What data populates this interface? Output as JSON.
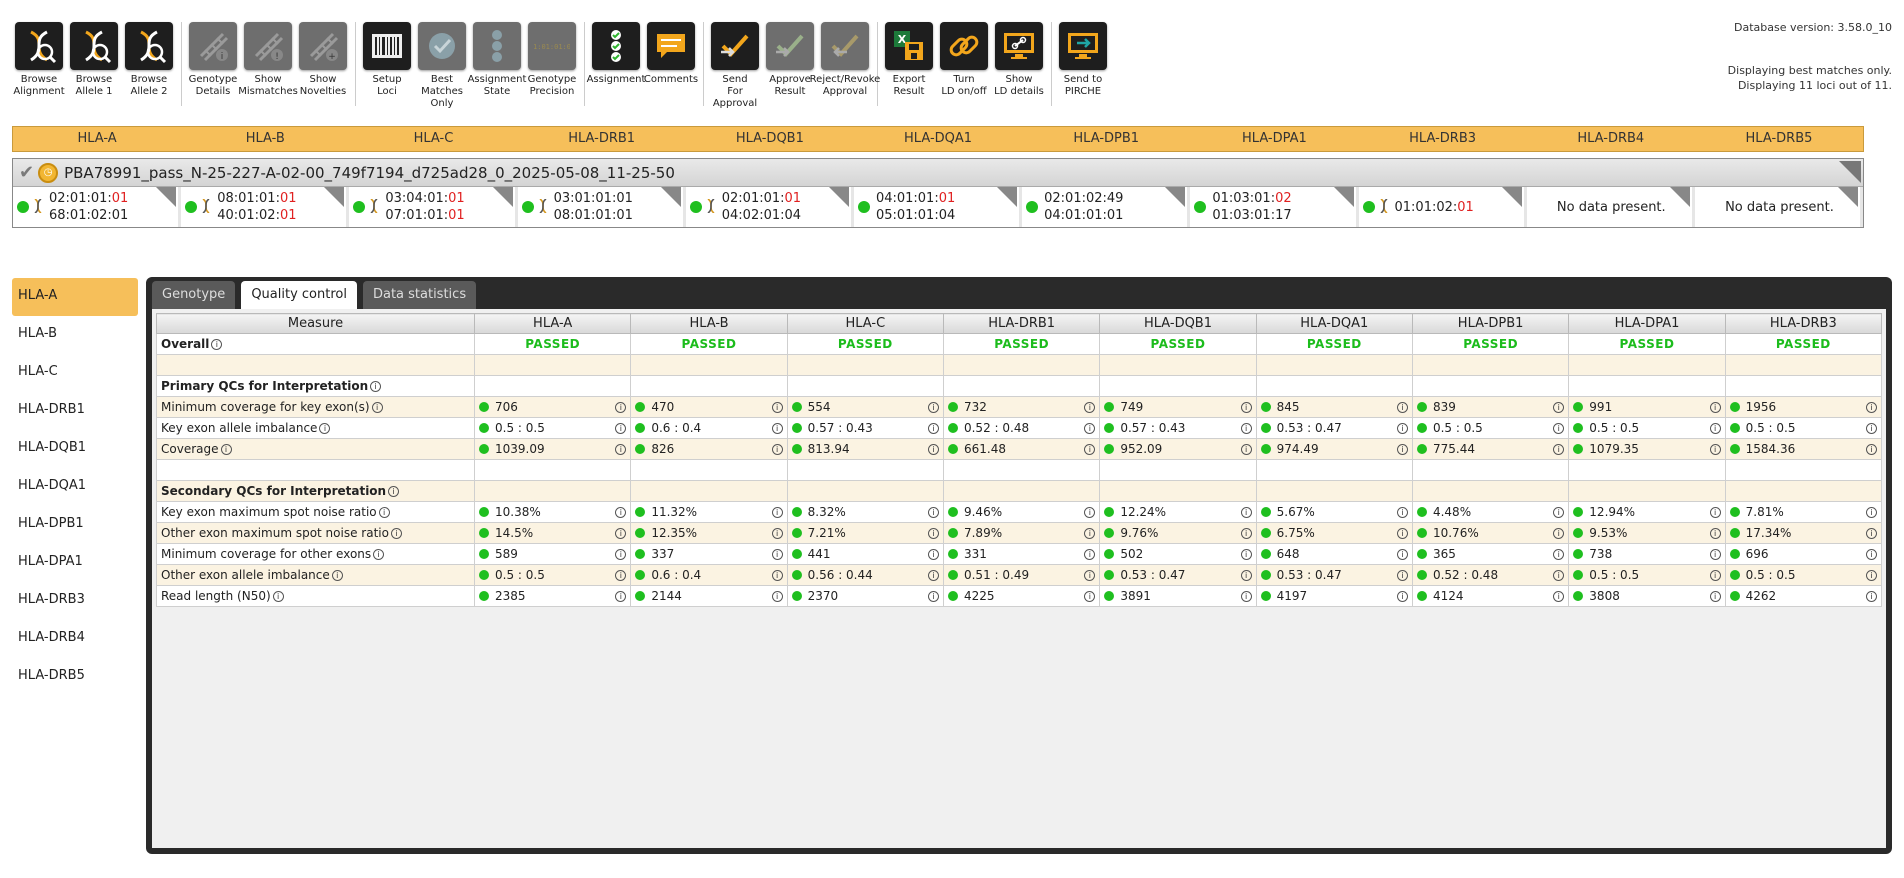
{
  "toolbar": {
    "groups": [
      [
        {
          "label": "Browse\nAlignment",
          "icon": "dna-browse-icon",
          "disabled": false
        },
        {
          "label": "Browse\nAllele 1",
          "icon": "dna-browse-icon",
          "disabled": false
        },
        {
          "label": "Browse\nAllele 2",
          "icon": "dna-browse-icon",
          "disabled": false
        }
      ],
      [
        {
          "label": "Genotype\nDetails",
          "icon": "dna-info-icon",
          "disabled": true
        },
        {
          "label": "Show\nMismatches",
          "icon": "dna-warning-icon",
          "disabled": true
        },
        {
          "label": "Show\nNovelties",
          "icon": "dna-plus-icon",
          "disabled": true
        }
      ],
      [
        {
          "label": "Setup\nLoci",
          "icon": "barcode-icon",
          "disabled": false
        },
        {
          "label": "Best Matches\nOnly",
          "icon": "check-circle-icon",
          "disabled": true
        },
        {
          "label": "Assignment\nState",
          "icon": "state-icon",
          "disabled": true
        },
        {
          "label": "Genotype\nPrecision",
          "icon": "binary-icon",
          "disabled": true
        }
      ],
      [
        {
          "label": "Assignment",
          "icon": "checklist-icon",
          "disabled": false
        },
        {
          "label": "Comments",
          "icon": "comment-icon",
          "disabled": false
        }
      ],
      [
        {
          "label": "Send\nFor Approval",
          "icon": "send-approval-icon",
          "disabled": false
        },
        {
          "label": "Approve\nResult",
          "icon": "approve-icon",
          "disabled": true
        },
        {
          "label": "Reject/Revoke\nApproval",
          "icon": "reject-icon",
          "disabled": true
        }
      ],
      [
        {
          "label": "Export\nResult",
          "icon": "export-excel-icon",
          "disabled": false
        },
        {
          "label": "Turn\nLD on/off",
          "icon": "link-icon",
          "disabled": false
        },
        {
          "label": "Show\nLD details",
          "icon": "monitor-link-icon",
          "disabled": false
        }
      ],
      [
        {
          "label": "Send to\nPIRCHE",
          "icon": "monitor-send-icon",
          "disabled": false
        }
      ]
    ]
  },
  "db_info": {
    "version": "Database version: 3.58.0_10",
    "line1": "Displaying best matches only.",
    "line2": "Displaying 11 loci out of 11."
  },
  "loci": [
    "HLA-A",
    "HLA-B",
    "HLA-C",
    "HLA-DRB1",
    "HLA-DQB1",
    "HLA-DQA1",
    "HLA-DPB1",
    "HLA-DPA1",
    "HLA-DRB3",
    "HLA-DRB4",
    "HLA-DRB5"
  ],
  "sample": {
    "name": "PBA78991_pass_N-25-227-A-02-00_749f7194_d725ad28_0_2025-05-08_11-25-50",
    "cells": [
      {
        "dna": true,
        "a1": [
          "02:01:01:",
          "01"
        ],
        "a2": [
          "68:01:02:01",
          ""
        ]
      },
      {
        "dna": true,
        "a1": [
          "08:01:01:",
          "01"
        ],
        "a2": [
          "40:01:02:",
          "01"
        ]
      },
      {
        "dna": true,
        "a1": [
          "03:04:01:",
          "01"
        ],
        "a2": [
          "07:01:01:",
          "01"
        ]
      },
      {
        "dna": true,
        "a1": [
          "03:01:01:01",
          ""
        ],
        "a2": [
          "08:01:01:01",
          ""
        ]
      },
      {
        "dna": true,
        "a1": [
          "02:01:01:",
          "01"
        ],
        "a2": [
          "04:02:01:04",
          ""
        ]
      },
      {
        "dna": false,
        "a1": [
          "04:01:01:",
          "01"
        ],
        "a2": [
          "05:01:01:04",
          ""
        ]
      },
      {
        "dna": false,
        "a1": [
          "02:01:02:49",
          ""
        ],
        "a2": [
          "04:01:01:01",
          ""
        ]
      },
      {
        "dna": false,
        "a1": [
          "01:03:01:",
          "02"
        ],
        "a2": [
          "01:03:01:17",
          ""
        ]
      },
      {
        "dna": true,
        "a1": [
          "01:01:02:",
          "01"
        ],
        "a2": null
      },
      {
        "nodata": "No data present."
      },
      {
        "nodata": "No data present."
      }
    ]
  },
  "tabs": [
    "Genotype",
    "Quality control",
    "Data statistics"
  ],
  "active_tab": 1,
  "qc": {
    "measure_header": "Measure",
    "columns": [
      "HLA-A",
      "HLA-B",
      "HLA-C",
      "HLA-DRB1",
      "HLA-DQB1",
      "HLA-DQA1",
      "HLA-DPB1",
      "HLA-DPA1",
      "HLA-DRB3"
    ],
    "overall_label": "Overall",
    "overall_value": "PASSED",
    "primary_label": "Primary QCs for Interpretation",
    "primary_rows": [
      {
        "name": "Minimum coverage for key exon(s)",
        "values": [
          "706",
          "470",
          "554",
          "732",
          "749",
          "845",
          "839",
          "991",
          "1956"
        ]
      },
      {
        "name": "Key exon allele imbalance",
        "values": [
          "0.5 : 0.5",
          "0.6 : 0.4",
          "0.57 : 0.43",
          "0.52 : 0.48",
          "0.57 : 0.43",
          "0.53 : 0.47",
          "0.5 : 0.5",
          "0.5 : 0.5",
          "0.5 : 0.5"
        ]
      },
      {
        "name": "Coverage",
        "values": [
          "1039.09",
          "826",
          "813.94",
          "661.48",
          "952.09",
          "974.49",
          "775.44",
          "1079.35",
          "1584.36"
        ]
      }
    ],
    "secondary_label": "Secondary QCs for Interpretation",
    "secondary_rows": [
      {
        "name": "Key exon maximum spot noise ratio",
        "values": [
          "10.38%",
          "11.32%",
          "8.32%",
          "9.46%",
          "12.24%",
          "5.67%",
          "4.48%",
          "12.94%",
          "7.81%"
        ]
      },
      {
        "name": "Other exon maximum spot noise ratio",
        "values": [
          "14.5%",
          "12.35%",
          "7.21%",
          "7.89%",
          "9.76%",
          "6.75%",
          "10.76%",
          "9.53%",
          "17.34%"
        ]
      },
      {
        "name": "Minimum coverage for other exons",
        "values": [
          "589",
          "337",
          "441",
          "331",
          "502",
          "648",
          "365",
          "738",
          "696"
        ]
      },
      {
        "name": "Other exon allele imbalance",
        "values": [
          "0.5 : 0.5",
          "0.6 : 0.4",
          "0.56 : 0.44",
          "0.51 : 0.49",
          "0.53 : 0.47",
          "0.53 : 0.47",
          "0.52 : 0.48",
          "0.5 : 0.5",
          "0.5 : 0.5"
        ]
      },
      {
        "name": "Read length (N50)",
        "values": [
          "2385",
          "2144",
          "2370",
          "4225",
          "3891",
          "4197",
          "4124",
          "3808",
          "4262"
        ]
      }
    ]
  },
  "colors": {
    "accent": "#f6bf5a",
    "pass": "#1cbc1c",
    "dot": "#1fbf1f",
    "red": "#e02020"
  }
}
